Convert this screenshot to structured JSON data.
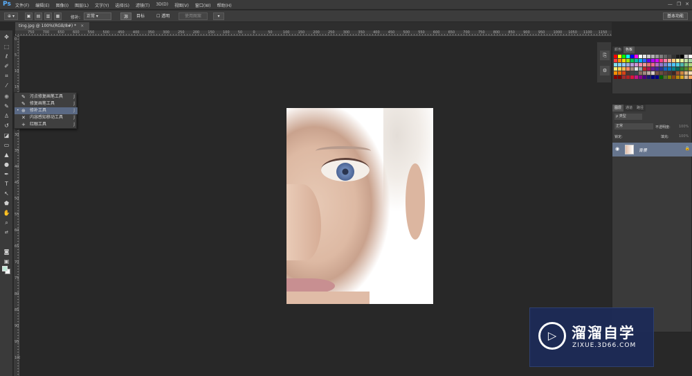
{
  "app": {
    "logo": "Ps"
  },
  "menu": [
    "文件(F)",
    "编辑(E)",
    "图像(I)",
    "图层(L)",
    "文字(Y)",
    "选择(S)",
    "滤镜(T)",
    "3D(D)",
    "视图(V)",
    "窗口(W)",
    "帮助(H)"
  ],
  "window_controls": [
    "—",
    "❐",
    "✕"
  ],
  "options_bar": {
    "patch_label": "修补:",
    "patch_mode": "正常",
    "source": "源",
    "target": "目标",
    "transparent": "透明",
    "use_pattern": "使用图案",
    "workspace": "基本功能"
  },
  "document": {
    "tab_title": "ting.jpg @ 100%(RGB/8#) *",
    "close": "×"
  },
  "ruler": {
    "top": [
      "750",
      "700",
      "650",
      "600",
      "550",
      "500",
      "450",
      "400",
      "350",
      "300",
      "250",
      "200",
      "150",
      "100",
      "50",
      "0",
      "50",
      "100",
      "150",
      "200",
      "250",
      "300",
      "350",
      "400",
      "450",
      "500",
      "550",
      "600",
      "650",
      "700",
      "750",
      "800",
      "850",
      "900",
      "950",
      "1000",
      "1050",
      "1100",
      "1150"
    ],
    "left": [
      "0",
      "5",
      "10",
      "15",
      "20",
      "25",
      "30",
      "35",
      "40",
      "45",
      "50",
      "55",
      "60",
      "65",
      "70",
      "75",
      "80",
      "85",
      "90",
      "95",
      "100"
    ]
  },
  "tool_menu": {
    "items": [
      {
        "icon": "✎",
        "label": "污点修复画笔工具",
        "key": "J",
        "selected": false
      },
      {
        "icon": "✎",
        "label": "修复画笔工具",
        "key": "J",
        "selected": false
      },
      {
        "icon": "⊕",
        "label": "修补工具",
        "key": "J",
        "selected": true
      },
      {
        "icon": "✕",
        "label": "内容感知移动工具",
        "key": "J",
        "selected": false
      },
      {
        "icon": "+",
        "label": "红眼工具",
        "key": "J",
        "selected": false
      }
    ],
    "selected_marker": "•"
  },
  "colors": {
    "foreground": "#bfe8d8",
    "background": "#ffffff",
    "accent": "#5a6984",
    "selected_layer": "#66758e"
  },
  "panels": {
    "swatches_tabs": [
      "颜色",
      "色板"
    ],
    "layers_tabs": [
      "图层",
      "通道",
      "路径"
    ],
    "layer_kind": "ρ 类型",
    "blend_mode": "正常",
    "opacity_label": "不透明度:",
    "opacity_value": "100%",
    "lock_label": "锁定:",
    "fill_label": "填充:",
    "fill_value": "100%",
    "layer_name": "背景"
  },
  "watermark": {
    "title": "溜溜自学",
    "subtitle": "ZIXUE.3D66.COM"
  }
}
